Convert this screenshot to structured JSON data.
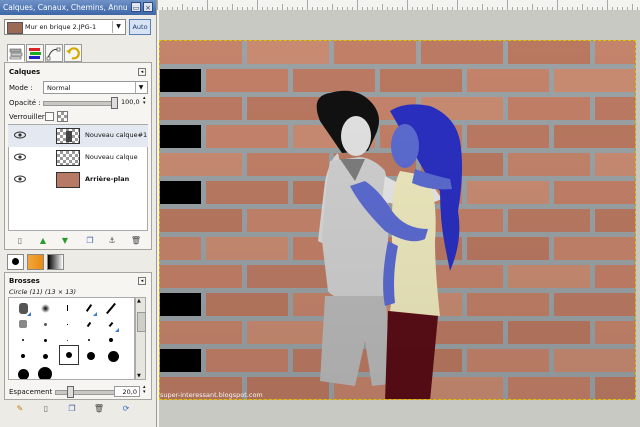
{
  "window": {
    "title": "Calques, Canaux, Chemins, Annuler..."
  },
  "image_selector": {
    "value": "Mur en brique 2.JPG-1",
    "auto_label": "Auto"
  },
  "layers_panel": {
    "title": "Calques",
    "mode_label": "Mode :",
    "mode_value": "Normal",
    "opacity_label": "Opacité :",
    "opacity_value": "100,0",
    "opacity_fraction": 1.0,
    "lock_label": "Verrouiller :",
    "layers": [
      {
        "name": "Nouveau calque#1",
        "visible": true,
        "thumb": "figures"
      },
      {
        "name": "Nouveau calque",
        "visible": true,
        "thumb": "transparent"
      },
      {
        "name": "Arrière-plan",
        "visible": true,
        "thumb": "brick",
        "bold": true
      }
    ]
  },
  "brushes_panel": {
    "title": "Brosses",
    "current_brush": "Circle (11) (13 × 13)",
    "spacing_label": "Espacement :",
    "spacing_value": "20,0",
    "spacing_fraction": 0.2
  },
  "canvas": {
    "watermark": "super-interessant.blogspot.com"
  },
  "colors": {
    "title_bar": "#4a72b0",
    "brick": "#bf8069",
    "mortar": "#9aa2a6",
    "selection": "#d9c300"
  }
}
